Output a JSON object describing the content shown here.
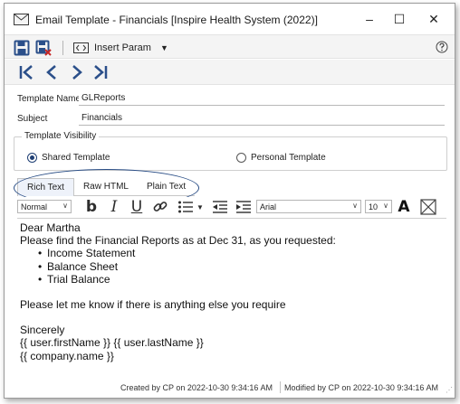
{
  "window": {
    "title": "Email Template - Financials [Inspire Health System (2022)]",
    "minimize_glyph": "–",
    "maximize_glyph": "☐",
    "close_glyph": "✕"
  },
  "toolbar": {
    "insert_param_label": "Insert Param",
    "insert_param_caret": "▼",
    "help_icon": "question-circle-icon"
  },
  "nav": {
    "icons": [
      "first-record-icon",
      "previous-record-icon",
      "next-record-icon",
      "last-record-icon"
    ]
  },
  "form": {
    "template_name_label": "Template Name",
    "template_name_value": "GLReports",
    "subject_label": "Subject",
    "subject_value": "Financials",
    "visibility_legend": "Template Visibility",
    "shared_label": "Shared Template",
    "personal_label": "Personal Template",
    "selected_visibility": "Shared Template"
  },
  "tabs": [
    {
      "label": "Rich Text",
      "active": true
    },
    {
      "label": "Raw HTML",
      "active": false
    },
    {
      "label": "Plain Text",
      "active": false
    }
  ],
  "editor_toolbar": {
    "style_value": "Normal",
    "font_value": "Arial",
    "size_value": "10",
    "bold_glyph": "b",
    "italic_glyph": "I",
    "underline_glyph": "U",
    "color_glyph": "A",
    "caret": "∨",
    "list_caret": "▼"
  },
  "editor": {
    "greeting": "Dear Martha",
    "intro": "Please find the Financial Reports as at Dec 31, as you requested:",
    "bullets": [
      "Income Statement",
      "Balance Sheet",
      "Trial Balance"
    ],
    "bullet_glyph": "•",
    "closing_request": "Please let me know if there is anything else you require",
    "signoff": "Sincerely",
    "name_line": "{{ user.firstName }} {{ user.lastName }}",
    "company_line": "{{ company.name }}"
  },
  "status": {
    "created": "Created by CP on 2022-10-30 9:34:16 AM",
    "modified": "Modified by CP on 2022-10-30 9:34:16 AM",
    "grip": "⋰"
  },
  "colors": {
    "accent_blue": "#2b4f8a",
    "save_close_red": "#c62828",
    "highlight_oval": "#2a4e86"
  }
}
